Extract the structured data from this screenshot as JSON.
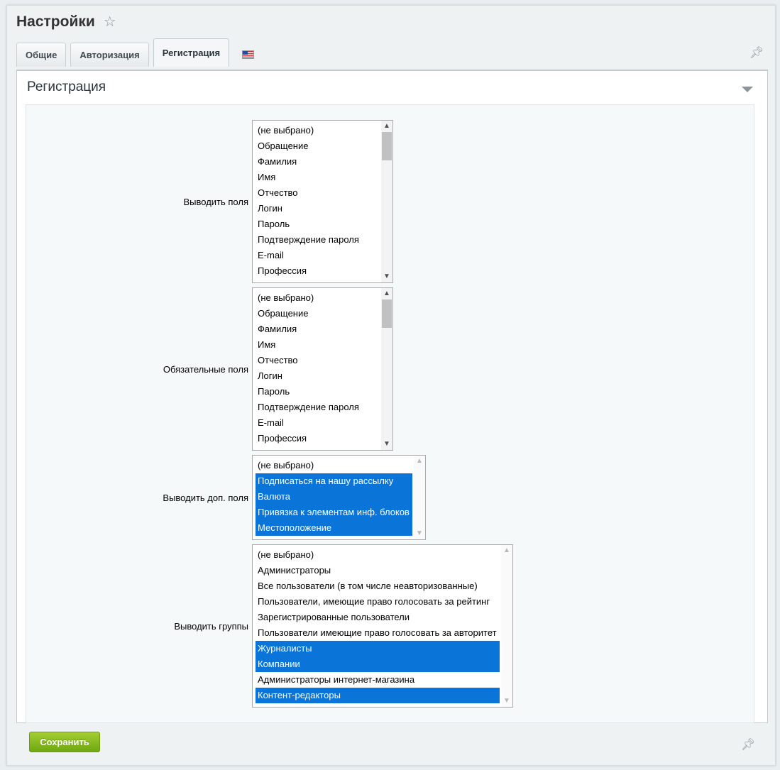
{
  "header": {
    "title": "Настройки",
    "star_icon": "star-icon"
  },
  "tabs": [
    {
      "label": "Общие",
      "active": false
    },
    {
      "label": "Авторизация",
      "active": false
    },
    {
      "label": "Регистрация",
      "active": true
    }
  ],
  "language_tab_icon": "us-flag-icon",
  "section": {
    "title": "Регистрация"
  },
  "fields": {
    "show_fields": {
      "label": "Выводить поля",
      "options": [
        "(не выбрано)",
        "Обращение",
        "Фамилия",
        "Имя",
        "Отчество",
        "Логин",
        "Пароль",
        "Подтверждение пароля",
        "E-mail",
        "Профессия"
      ],
      "selected": []
    },
    "required_fields": {
      "label": "Обязательные поля",
      "options": [
        "(не выбрано)",
        "Обращение",
        "Фамилия",
        "Имя",
        "Отчество",
        "Логин",
        "Пароль",
        "Подтверждение пароля",
        "E-mail",
        "Профессия"
      ],
      "selected": []
    },
    "extra_fields": {
      "label": "Выводить доп. поля",
      "options": [
        "(не выбрано)",
        "Подписаться на нашу рассылку",
        "Валюта",
        "Привязка к элементам инф. блоков",
        "Местоположение"
      ],
      "selected": [
        1,
        2,
        3,
        4
      ]
    },
    "groups": {
      "label": "Выводить группы",
      "options": [
        "(не выбрано)",
        "Администраторы",
        "Все пользователи (в том числе неавторизованные)",
        "Пользователи, имеющие право голосовать за рейтинг",
        "Зарегистрированные пользователи",
        "Пользователи имеющие право голосовать за авторитет",
        "Журналисты",
        "Компании",
        "Администраторы интернет-магазина",
        "Контент-редакторы"
      ],
      "selected": [
        6,
        7,
        9
      ]
    }
  },
  "footer": {
    "save_label": "Сохранить"
  },
  "colors": {
    "selection": "#0a74d9",
    "save_button": "#8bbf1f"
  }
}
